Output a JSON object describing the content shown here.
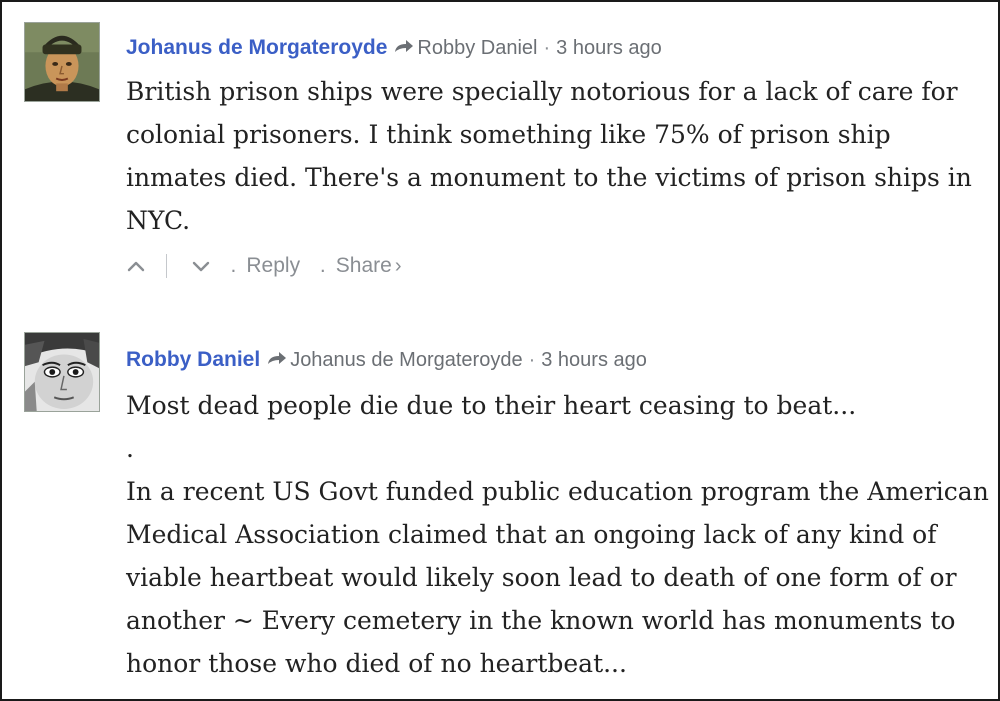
{
  "comments": [
    {
      "author": "Johanus de Morgateroyde",
      "reply_to": "Robby Daniel",
      "separator": "·",
      "time": "3 hours ago",
      "paragraphs": [
        "British prison ships were specially notorious for a lack of care for colonial prisoners. I think something like 75% of prison ship inmates died. There's a monument to the victims of prison ships in NYC."
      ],
      "actions": {
        "upvote_icon": "chevron-up-icon",
        "downvote_icon": "chevron-down-icon",
        "dot": ".",
        "reply": "Reply",
        "share": "Share",
        "share_chevron": "›"
      }
    },
    {
      "author": "Robby Daniel",
      "reply_to": "Johanus de Morgateroyde",
      "separator": "·",
      "time": "3 hours ago",
      "paragraphs": [
        "Most dead people die due to their heart ceasing to beat...",
        ".",
        "In a recent US Govt funded public education program the American Medical Association claimed that an ongoing lack of any kind of viable heartbeat would likely soon lead to death of one form of or another ~ Every cemetery in the known world has monuments to honor those who died of no heartbeat..."
      ]
    }
  ],
  "colors": {
    "author_link": "#3b5fc6",
    "meta_text": "#6b6f74",
    "body_text": "#222222",
    "action_text": "#8a8e93",
    "frame_border": "#1a1a1a"
  }
}
